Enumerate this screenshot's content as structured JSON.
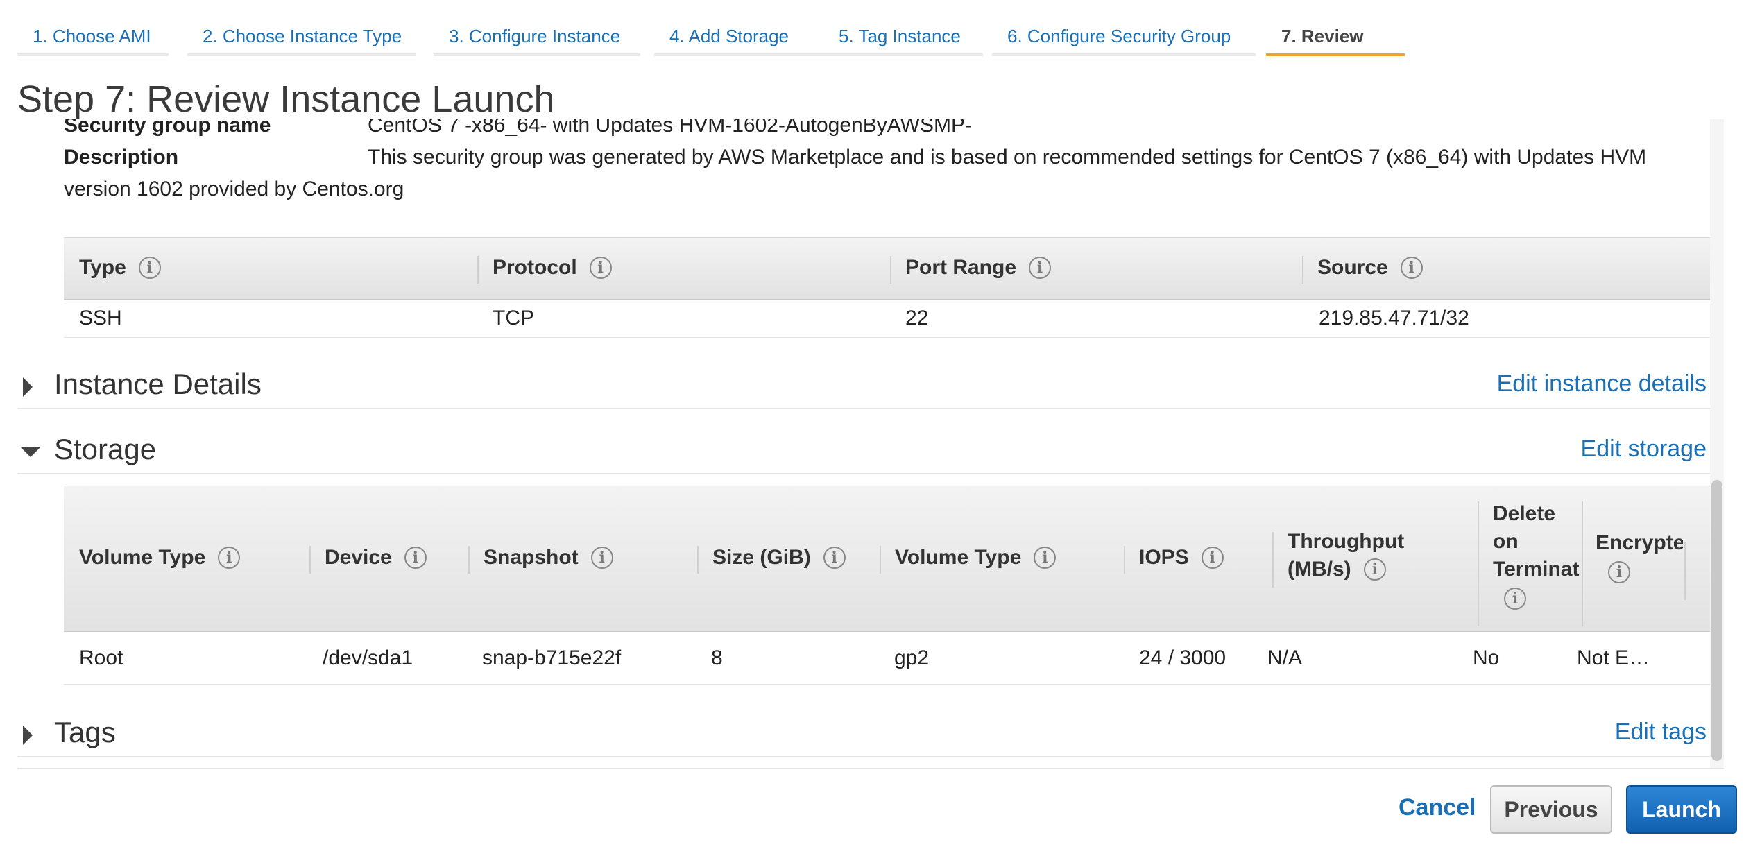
{
  "tabs": [
    {
      "label": "1. Choose AMI"
    },
    {
      "label": "2. Choose Instance Type"
    },
    {
      "label": "3. Configure Instance"
    },
    {
      "label": "4. Add Storage"
    },
    {
      "label": "5. Tag Instance"
    },
    {
      "label": "6. Configure Security Group"
    },
    {
      "label": "7. Review",
      "active": true
    }
  ],
  "page_title": "Step 7: Review Instance Launch",
  "security_group": {
    "name_label": "Security group name",
    "name_value": "CentOS 7 -x86_64- with Updates HVM-1602-AutogenByAWSMP-",
    "description_label": "Description",
    "description_value": "This security group was generated by AWS Marketplace and is based on recommended settings for CentOS 7 (x86_64) with Updates HVM",
    "description_value_cont": "version 1602 provided by Centos.org"
  },
  "rules_table": {
    "headers": [
      "Type",
      "Protocol",
      "Port Range",
      "Source"
    ],
    "rows": [
      [
        "SSH",
        "TCP",
        "22",
        "219.85.47.71/32"
      ]
    ]
  },
  "sections": {
    "instance_details": {
      "title": "Instance Details",
      "link": "Edit instance details"
    },
    "storage": {
      "title": "Storage",
      "link": "Edit storage"
    },
    "tags": {
      "title": "Tags",
      "link": "Edit tags"
    }
  },
  "storage_table": {
    "headers": [
      "Volume Type",
      "Device",
      "Snapshot",
      "Size (GiB)",
      "Volume Type",
      "IOPS",
      "Throughput (MB/s)",
      "Delete on Terminat",
      "Encrypte"
    ],
    "header_lines": {
      "throughput": [
        "Throughput",
        "(MB/s)"
      ],
      "delete": [
        "Delete",
        "on",
        "Terminat"
      ]
    },
    "rows": [
      [
        "Root",
        "/dev/sda1",
        "snap-b715e22f",
        "8",
        "gp2",
        "24 / 3000",
        "N/A",
        "No",
        "Not E…"
      ]
    ]
  },
  "footer": {
    "cancel": "Cancel",
    "previous": "Previous",
    "launch": "Launch"
  },
  "colors": {
    "accent": "#1a6fb5",
    "active_tab": "#f0a22e",
    "launch_button": "#1a70c2"
  }
}
